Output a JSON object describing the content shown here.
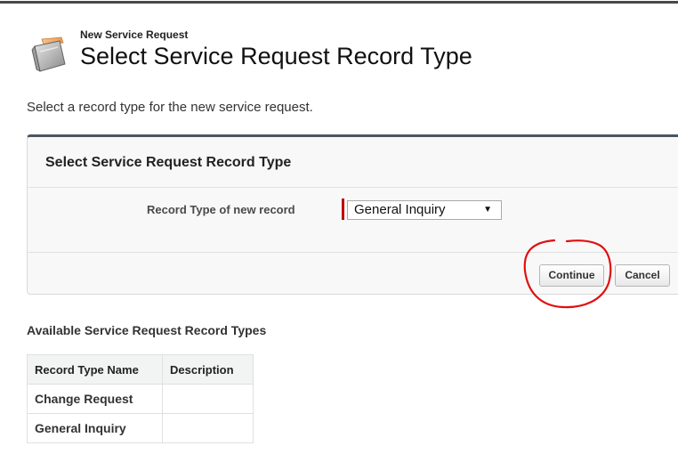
{
  "header": {
    "subtitle": "New Service Request",
    "title": "Select Service Request Record Type"
  },
  "instruction": "Select a record type for the new service request.",
  "panel": {
    "title": "Select Service Request Record Type",
    "field_label": "Record Type of new record",
    "select_value": "General Inquiry",
    "select_arrow": "▼",
    "continue_label": "Continue",
    "cancel_label": "Cancel"
  },
  "record_types": {
    "heading": "Available Service Request Record Types",
    "columns": [
      "Record Type Name",
      "Description"
    ],
    "rows": [
      {
        "name": "Change Request",
        "description": ""
      },
      {
        "name": "General Inquiry",
        "description": ""
      }
    ]
  },
  "icons": {
    "title_icon": "service-request-icon",
    "annotation": "red-hand-drawn-circle"
  },
  "colors": {
    "panel_border_top": "#4b5660",
    "required_bar": "#c00000",
    "annotation": "#e01010"
  }
}
